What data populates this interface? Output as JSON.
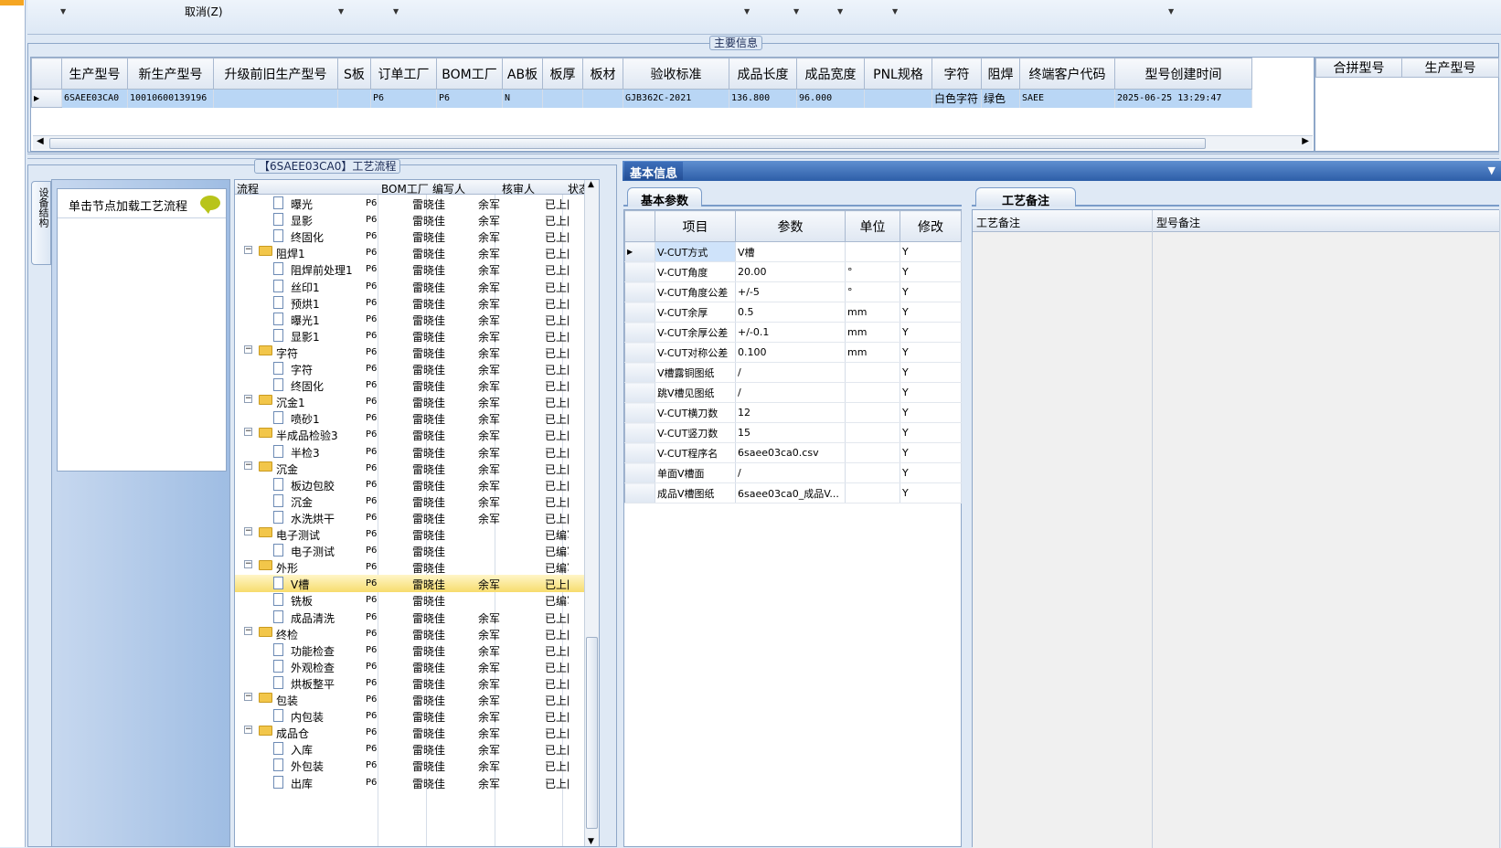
{
  "toolbar": {
    "cancel_label": "取消(Z)"
  },
  "main_info": {
    "caption": "主要信息",
    "columns": [
      "生产型号",
      "新生产型号",
      "升级前旧生产型号",
      "S板",
      "订单工厂",
      "BOM工厂",
      "AB板",
      "板厚",
      "板材",
      "验收标准",
      "成品长度",
      "成品宽度",
      "PNL规格",
      "字符",
      "阻焊",
      "终端客户代码",
      "型号创建时间"
    ],
    "row": {
      "prod_model": "6SAEE03CA0",
      "new_model": "10010600139196",
      "old_model": "",
      "s_board": "",
      "order_factory": "P6",
      "bom_factory": "P6",
      "ab_board": "N",
      "thickness": "",
      "material": "",
      "acceptance": "GJB362C-2021",
      "length": "136.800",
      "width": "96.000",
      "pnl": "",
      "char": "白色字符",
      "solder": "绿色",
      "customer": "SAEE",
      "created": "2025-06-25 13:29:47"
    },
    "side_columns": [
      "合拼型号",
      "生产型号"
    ]
  },
  "flow": {
    "caption": "【6SAEE03CA0】工艺流程",
    "vertical_tab": "设备结构",
    "node_hint": "单击节点加载工艺流程",
    "tree_columns": [
      "流程",
      "BOM工厂",
      "编写人",
      "核审人",
      "状态"
    ],
    "rows": [
      {
        "level": 2,
        "type": "doc",
        "name": "曝光",
        "fac": "P6",
        "writer": "雷晓佳",
        "reviewer": "余军",
        "status": "已上网"
      },
      {
        "level": 2,
        "type": "doc",
        "name": "显影",
        "fac": "P6",
        "writer": "雷晓佳",
        "reviewer": "余军",
        "status": "已上网"
      },
      {
        "level": 2,
        "type": "doc",
        "name": "终固化",
        "fac": "P6",
        "writer": "雷晓佳",
        "reviewer": "余军",
        "status": "已上网"
      },
      {
        "level": 1,
        "type": "folder",
        "name": "阻焊1",
        "fac": "P6",
        "writer": "雷晓佳",
        "reviewer": "余军",
        "status": "已上网"
      },
      {
        "level": 2,
        "type": "doc",
        "name": "阻焊前处理1",
        "fac": "P6",
        "writer": "雷晓佳",
        "reviewer": "余军",
        "status": "已上网"
      },
      {
        "level": 2,
        "type": "doc",
        "name": "丝印1",
        "fac": "P6",
        "writer": "雷晓佳",
        "reviewer": "余军",
        "status": "已上网"
      },
      {
        "level": 2,
        "type": "doc",
        "name": "预烘1",
        "fac": "P6",
        "writer": "雷晓佳",
        "reviewer": "余军",
        "status": "已上网"
      },
      {
        "level": 2,
        "type": "doc",
        "name": "曝光1",
        "fac": "P6",
        "writer": "雷晓佳",
        "reviewer": "余军",
        "status": "已上网"
      },
      {
        "level": 2,
        "type": "doc",
        "name": "显影1",
        "fac": "P6",
        "writer": "雷晓佳",
        "reviewer": "余军",
        "status": "已上网"
      },
      {
        "level": 1,
        "type": "folder",
        "name": "字符",
        "fac": "P6",
        "writer": "雷晓佳",
        "reviewer": "余军",
        "status": "已上网"
      },
      {
        "level": 2,
        "type": "doc",
        "name": "字符",
        "fac": "P6",
        "writer": "雷晓佳",
        "reviewer": "余军",
        "status": "已上网"
      },
      {
        "level": 2,
        "type": "doc",
        "name": "终固化",
        "fac": "P6",
        "writer": "雷晓佳",
        "reviewer": "余军",
        "status": "已上网"
      },
      {
        "level": 1,
        "type": "folder",
        "name": "沉金1",
        "fac": "P6",
        "writer": "雷晓佳",
        "reviewer": "余军",
        "status": "已上网"
      },
      {
        "level": 2,
        "type": "doc",
        "name": "喷砂1",
        "fac": "P6",
        "writer": "雷晓佳",
        "reviewer": "余军",
        "status": "已上网"
      },
      {
        "level": 1,
        "type": "folder",
        "name": "半成品检验3",
        "fac": "P6",
        "writer": "雷晓佳",
        "reviewer": "余军",
        "status": "已上网"
      },
      {
        "level": 2,
        "type": "doc",
        "name": "半检3",
        "fac": "P6",
        "writer": "雷晓佳",
        "reviewer": "余军",
        "status": "已上网"
      },
      {
        "level": 1,
        "type": "folder",
        "name": "沉金",
        "fac": "P6",
        "writer": "雷晓佳",
        "reviewer": "余军",
        "status": "已上网"
      },
      {
        "level": 2,
        "type": "doc",
        "name": "板边包胶",
        "fac": "P6",
        "writer": "雷晓佳",
        "reviewer": "余军",
        "status": "已上网"
      },
      {
        "level": 2,
        "type": "doc",
        "name": "沉金",
        "fac": "P6",
        "writer": "雷晓佳",
        "reviewer": "余军",
        "status": "已上网"
      },
      {
        "level": 2,
        "type": "doc",
        "name": "水洗烘干",
        "fac": "P6",
        "writer": "雷晓佳",
        "reviewer": "余军",
        "status": "已上网"
      },
      {
        "level": 1,
        "type": "folder",
        "name": "电子测试",
        "fac": "P6",
        "writer": "雷晓佳",
        "reviewer": "",
        "status": "已编写"
      },
      {
        "level": 2,
        "type": "doc",
        "name": "电子测试",
        "fac": "P6",
        "writer": "雷晓佳",
        "reviewer": "",
        "status": "已编写"
      },
      {
        "level": 1,
        "type": "folder",
        "name": "外形",
        "fac": "P6",
        "writer": "雷晓佳",
        "reviewer": "",
        "status": "已编写"
      },
      {
        "level": 2,
        "type": "doc",
        "name": "V槽",
        "fac": "P6",
        "writer": "雷晓佳",
        "reviewer": "余军",
        "status": "已上网",
        "hl": true
      },
      {
        "level": 2,
        "type": "doc",
        "name": "铣板",
        "fac": "P6",
        "writer": "雷晓佳",
        "reviewer": "",
        "status": "已编写"
      },
      {
        "level": 2,
        "type": "doc",
        "name": "成品清洗",
        "fac": "P6",
        "writer": "雷晓佳",
        "reviewer": "余军",
        "status": "已上网"
      },
      {
        "level": 1,
        "type": "folder",
        "name": "终检",
        "fac": "P6",
        "writer": "雷晓佳",
        "reviewer": "余军",
        "status": "已上网"
      },
      {
        "level": 2,
        "type": "doc",
        "name": "功能检查",
        "fac": "P6",
        "writer": "雷晓佳",
        "reviewer": "余军",
        "status": "已上网"
      },
      {
        "level": 2,
        "type": "doc",
        "name": "外观检查",
        "fac": "P6",
        "writer": "雷晓佳",
        "reviewer": "余军",
        "status": "已上网"
      },
      {
        "level": 2,
        "type": "doc",
        "name": "烘板整平",
        "fac": "P6",
        "writer": "雷晓佳",
        "reviewer": "余军",
        "status": "已上网"
      },
      {
        "level": 1,
        "type": "folder",
        "name": "包装",
        "fac": "P6",
        "writer": "雷晓佳",
        "reviewer": "余军",
        "status": "已上网"
      },
      {
        "level": 2,
        "type": "doc",
        "name": "内包装",
        "fac": "P6",
        "writer": "雷晓佳",
        "reviewer": "余军",
        "status": "已上网"
      },
      {
        "level": 1,
        "type": "folder",
        "name": "成品仓",
        "fac": "P6",
        "writer": "雷晓佳",
        "reviewer": "余军",
        "status": "已上网"
      },
      {
        "level": 2,
        "type": "doc",
        "name": "入库",
        "fac": "P6",
        "writer": "雷晓佳",
        "reviewer": "余军",
        "status": "已上网"
      },
      {
        "level": 2,
        "type": "doc",
        "name": "外包装",
        "fac": "P6",
        "writer": "雷晓佳",
        "reviewer": "余军",
        "status": "已上网"
      },
      {
        "level": 2,
        "type": "doc",
        "name": "出库",
        "fac": "P6",
        "writer": "雷晓佳",
        "reviewer": "余军",
        "status": "已上网"
      }
    ]
  },
  "basic": {
    "title": "基本信息",
    "tab_params": "基本参数",
    "tab_remarks": "工艺备注",
    "param_columns": [
      "项目",
      "参数",
      "单位",
      "修改"
    ],
    "params": [
      {
        "item": "V-CUT方式",
        "value": "V槽",
        "unit": "",
        "mod": "Y"
      },
      {
        "item": "V-CUT角度",
        "value": "20.00",
        "unit": "°",
        "mod": "Y"
      },
      {
        "item": "V-CUT角度公差",
        "value": "+/-5",
        "unit": "°",
        "mod": "Y"
      },
      {
        "item": "V-CUT余厚",
        "value": "0.5",
        "unit": "mm",
        "mod": "Y"
      },
      {
        "item": "V-CUT余厚公差",
        "value": "+/-0.1",
        "unit": "mm",
        "mod": "Y"
      },
      {
        "item": "V-CUT对称公差",
        "value": "0.100",
        "unit": "mm",
        "mod": "Y"
      },
      {
        "item": "V槽露铜图纸",
        "value": "/",
        "unit": "",
        "mod": "Y"
      },
      {
        "item": "跳V槽见图纸",
        "value": "/",
        "unit": "",
        "mod": "Y"
      },
      {
        "item": "V-CUT横刀数",
        "value": "12",
        "unit": "",
        "mod": "Y"
      },
      {
        "item": "V-CUT竖刀数",
        "value": "15",
        "unit": "",
        "mod": "Y"
      },
      {
        "item": "V-CUT程序名",
        "value": "6saee03ca0.csv",
        "unit": "",
        "mod": "Y"
      },
      {
        "item": "单面V槽面",
        "value": "/",
        "unit": "",
        "mod": "Y"
      },
      {
        "item": "成品V槽图纸",
        "value": "6saee03ca0_成品V...",
        "unit": "",
        "mod": "Y"
      }
    ],
    "remark_columns": [
      "工艺备注",
      "型号备注"
    ]
  }
}
